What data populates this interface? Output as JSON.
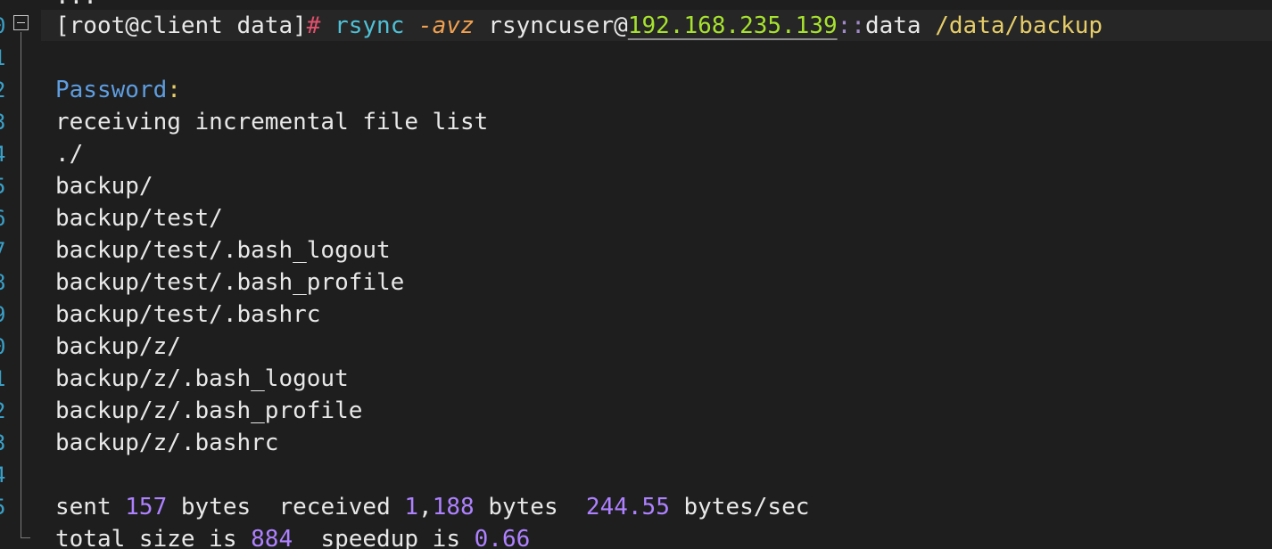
{
  "terminal": {
    "top_fragment": "..."
  },
  "gutter": {
    "line_numbers": [
      "0",
      "1",
      "2",
      "3",
      "4",
      "5",
      "6",
      "7",
      "8",
      "9",
      "0",
      "1",
      "2",
      "3",
      "4",
      "5"
    ]
  },
  "command": {
    "prompt": "[root@client data]",
    "hash": "#",
    "program": "rsync",
    "flags": "-avz",
    "user": "rsyncuser@",
    "host": "192.168.235.139",
    "separator": "::",
    "module": "data",
    "destination": "/data/backup"
  },
  "password_prompt": {
    "label": "Password",
    "colon": ":"
  },
  "output_lines": [
    "receiving incremental file list",
    "./",
    "backup/",
    "backup/test/",
    "backup/test/.bash_logout",
    "backup/test/.bash_profile",
    "backup/test/.bashrc",
    "backup/z/",
    "backup/z/.bash_logout",
    "backup/z/.bash_profile",
    "backup/z/.bashrc"
  ],
  "summary": {
    "sent_label": "sent",
    "sent_value": "157",
    "bytes_label_1": "bytes",
    "received_label": "received",
    "received_value_a": "1",
    "received_comma": ",",
    "received_value_b": "188",
    "bytes_label_2": "bytes",
    "rate_value": "244.55",
    "rate_unit": "bytes/sec"
  },
  "totals": {
    "total_label": "total size is",
    "total_value": "884",
    "speedup_label": "speedup is",
    "speedup_value": "0.66"
  },
  "colors": {
    "background": "#1e1e1e",
    "line_number": "#3aa0c8",
    "prompt_hash": "#e0506c",
    "command": "#4fc1d6",
    "flag": "#f0a050",
    "host": "#a6e22e",
    "path": "#e6cd69",
    "password": "#5e9de0",
    "number": "#ae81ff"
  }
}
